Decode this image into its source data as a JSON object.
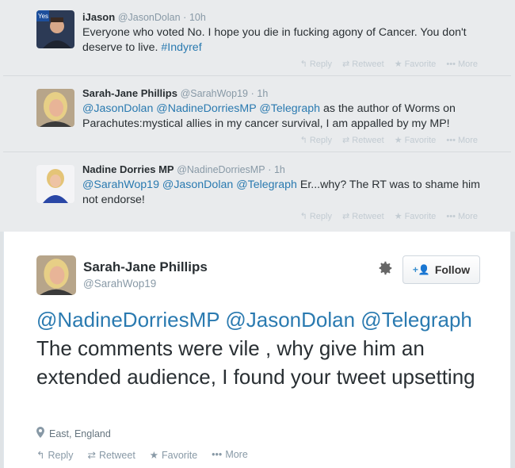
{
  "conversation": [
    {
      "name": "iJason",
      "handle": "@JasonDolan",
      "time": "10h",
      "text_parts": [
        {
          "t": "Everyone who voted No. I hope you die in fucking agony of Cancer. You don't deserve to live. "
        },
        {
          "t": "#Indyref",
          "link": true
        }
      ]
    },
    {
      "name": "Sarah-Jane Phillips",
      "handle": "@SarahWop19",
      "time": "1h",
      "text_parts": [
        {
          "t": "@JasonDolan",
          "link": true
        },
        {
          "t": " "
        },
        {
          "t": "@NadineDorriesMP",
          "link": true
        },
        {
          "t": " "
        },
        {
          "t": "@Telegraph",
          "link": true
        },
        {
          "t": " as the author of Worms on Parachutes:mystical allies in my cancer survival, I am appalled by my MP!"
        }
      ]
    },
    {
      "name": "Nadine Dorries MP",
      "handle": "@NadineDorriesMP",
      "time": "1h",
      "text_parts": [
        {
          "t": "@SarahWop19",
          "link": true
        },
        {
          "t": " "
        },
        {
          "t": "@JasonDolan",
          "link": true
        },
        {
          "t": " "
        },
        {
          "t": "@Telegraph",
          "link": true
        },
        {
          "t": " Er...why? The RT was to shame him not endorse!"
        }
      ]
    }
  ],
  "actions": {
    "reply": "Reply",
    "retweet": "Retweet",
    "favorite": "Favorite",
    "more": "More"
  },
  "main_tweet": {
    "name": "Sarah-Jane Phillips",
    "handle": "@SarahWop19",
    "follow_label": "Follow",
    "mentions": [
      "@NadineDorriesMP",
      "@JasonDolan",
      "@Telegraph"
    ],
    "body": "The comments were vile , why give him an extended audience, I found your tweet upsetting",
    "location": "East, England"
  },
  "colors": {
    "link": "#2a7ab0",
    "muted": "#8899a6",
    "conversation_bg": "#e9ebed"
  }
}
